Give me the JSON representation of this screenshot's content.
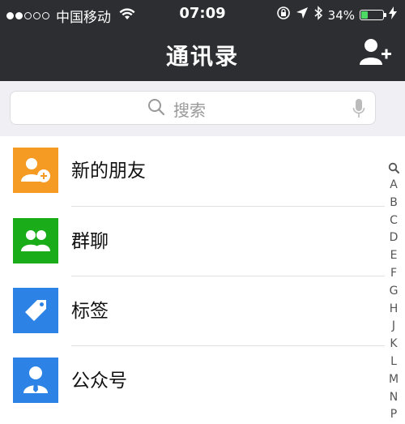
{
  "status_bar": {
    "carrier": "中国移动",
    "time": "07:09",
    "battery_percent": "34%",
    "battery_level": 0.34
  },
  "nav": {
    "title": "通讯录",
    "add_contact_icon": "add-person-icon"
  },
  "search": {
    "placeholder": "搜索"
  },
  "list": [
    {
      "label": "新的朋友",
      "icon": "new-friend-icon",
      "color": "#f59a23"
    },
    {
      "label": "群聊",
      "icon": "group-chat-icon",
      "color": "#1aad19"
    },
    {
      "label": "标签",
      "icon": "tag-icon",
      "color": "#2c82e5"
    },
    {
      "label": "公众号",
      "icon": "official-account-icon",
      "color": "#2c82e5"
    }
  ],
  "index_bar": [
    "A",
    "B",
    "C",
    "D",
    "E",
    "F",
    "G",
    "H",
    "J",
    "K",
    "L",
    "M",
    "N",
    "P"
  ],
  "colors": {
    "header_bg": "#2d2e32",
    "search_bg": "#efeff4",
    "battery_green": "#4cd964"
  }
}
